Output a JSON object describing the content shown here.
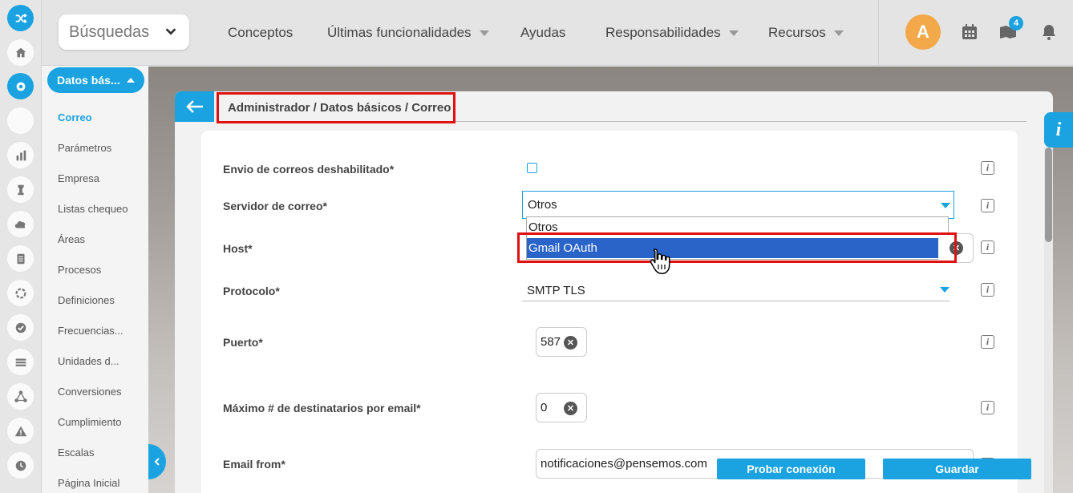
{
  "colors": {
    "accent": "#1aa3e0",
    "highlight_red": "#e01010",
    "selected_option": "#2a64c8",
    "avatar": "#f3a94a"
  },
  "rail": {
    "icons": [
      "shuffle-icon",
      "home-icon",
      "gear-icon",
      "blank-icon",
      "chart-icon",
      "chess-icon",
      "cloud-icon",
      "document-icon",
      "circle-icon",
      "check-icon",
      "menu-icon",
      "network-icon",
      "warning-icon",
      "clock-icon"
    ]
  },
  "header": {
    "search_label": "Búsquedas",
    "nav": [
      "Conceptos",
      "Últimas funcionalidades",
      "Ayudas",
      "Responsabilidades",
      "Recursos"
    ],
    "avatar_letter": "A",
    "notif_count": "4"
  },
  "sidebar": {
    "section": "Datos bás...",
    "items": [
      "Correo",
      "Parámetros",
      "Empresa",
      "Listas chequeo",
      "Áreas",
      "Procesos",
      "Definiciones",
      "Frecuencias...",
      "Unidades d...",
      "Conversiones",
      "Cumplimiento",
      "Escalas",
      "Página Inicial"
    ]
  },
  "breadcrumb": "Administrador / Datos básicos / Correo",
  "form": {
    "disabled_label": "Envio de correos deshabilitado*",
    "server_label": "Servidor de correo*",
    "server_value": "Otros",
    "server_options": [
      "Otros",
      "Gmail OAuth"
    ],
    "host_label": "Host*",
    "protocol_label": "Protocolo*",
    "protocol_value": "SMTP TLS",
    "port_label": "Puerto*",
    "port_value": "587",
    "max_label": "Máximo # de destinatarios por email*",
    "max_value": "0",
    "from_label": "Email from*",
    "from_value": "notificaciones@pensemos.com"
  },
  "actions": {
    "test": "Probar conexión",
    "save": "Guardar"
  },
  "info_tab": "i"
}
